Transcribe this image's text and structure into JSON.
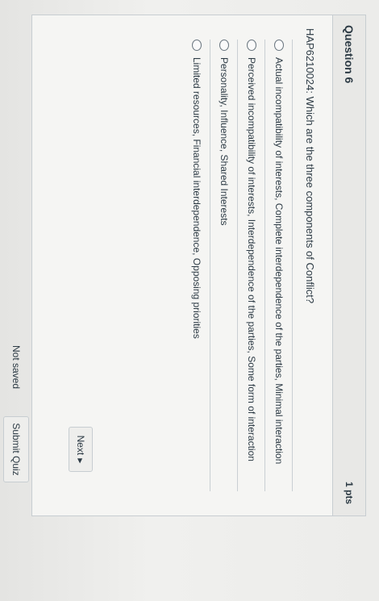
{
  "question": {
    "title": "Question 6",
    "points": "1 pts",
    "text": "HAP6210024: Which are the three components of Conflict?",
    "answers": [
      "Actual incompatibility of interests, Complete interdependence of the parties, Minimal interaction",
      "Perceived incompatibility of interests, Interdependence of the parties, Some form of interaction",
      "Personality, Influence, Shared Interests",
      "Limited resources, Financial interdependence, Opposing priorities"
    ]
  },
  "navigation": {
    "next_label": "Next",
    "next_icon": "caret-right-icon"
  },
  "footer": {
    "status": "Not saved",
    "submit_label": "Submit Quiz"
  }
}
